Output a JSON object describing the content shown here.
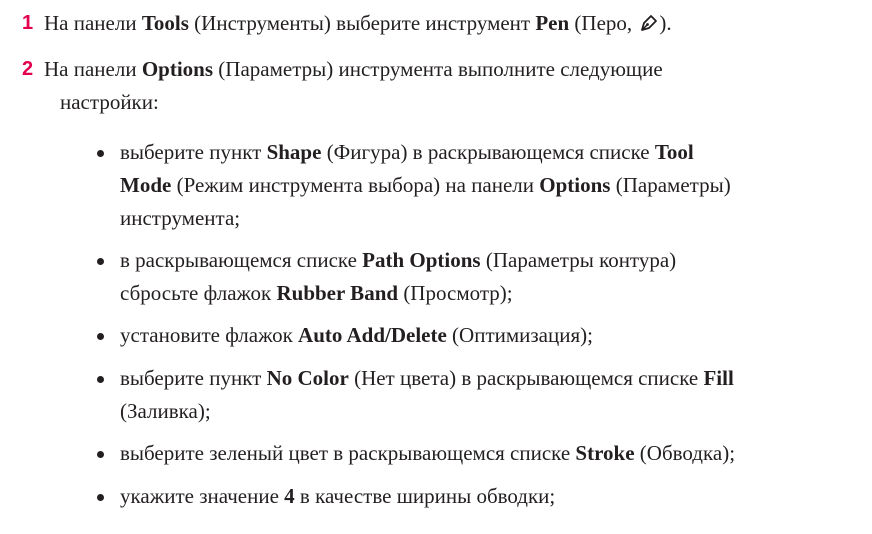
{
  "steps": [
    {
      "number": "1",
      "t1": "На панели ",
      "b1": "Tools",
      "t2": " (Инструменты) выберите инструмент ",
      "b2": "Pen",
      "t3": " (Перо, ",
      "t4": ")."
    },
    {
      "number": "2",
      "t1": "На панели ",
      "b1": "Options",
      "t2": " (Параметры) инструмента выполните следующие",
      "t3": "настройки:"
    }
  ],
  "bullets": [
    {
      "t1": "выберите пункт ",
      "b1": "Shape",
      "t2": " (Фигура) в раскрывающемся списке ",
      "b2": "Tool",
      "b3": "Mode",
      "t3": " (Режим инструмента выбора) на панели ",
      "b4": "Options",
      "t4": " (Параметры)",
      "t5": "инструмента;"
    },
    {
      "t1": "в раскрывающемся списке ",
      "b1": "Path Options",
      "t2": " (Параметры контура)",
      "t3": "сбросьте флажок ",
      "b2": "Rubber Band",
      "t4": " (Просмотр);"
    },
    {
      "t1": "установите флажок ",
      "b1": "Auto Add/Delete",
      "t2": " (Оптимизация);"
    },
    {
      "t1": "выберите пункт ",
      "b1": "No Color",
      "t2": " (Нет цвета) в раскрывающемся списке ",
      "b2": "Fill",
      "t3": "(Заливка);"
    },
    {
      "t1": "выберите зеленый цвет в раскрывающемся списке ",
      "b1": "Stroke",
      "t2": " (Обводка);"
    },
    {
      "t1": "укажите значение ",
      "b1": "4",
      "t2": " в качестве ширины обводки;"
    }
  ],
  "icons": {
    "pen": "pen-tool-icon"
  },
  "colors": {
    "step_number": "#e2004f",
    "text": "#231f20"
  }
}
